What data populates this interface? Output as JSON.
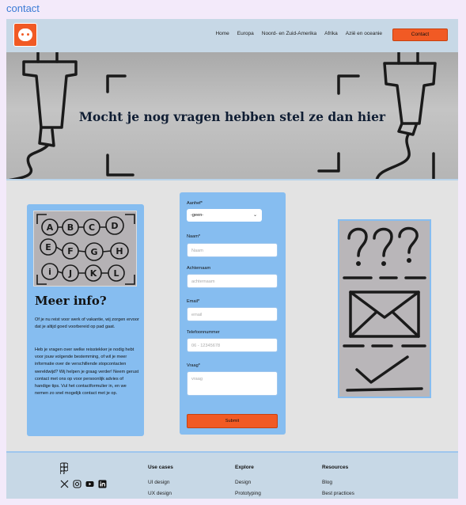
{
  "page_label": "contact",
  "header": {
    "nav": [
      "Home",
      "Europa",
      "Noord- en Zuid-Amerika",
      "Afrika",
      "Azië en oceanie"
    ],
    "contact_button": "Contact"
  },
  "hero": {
    "title": "Mocht je nog vragen hebben stel ze dan hier"
  },
  "info": {
    "title": "Meer info?",
    "p1": "Of je nu reist voor werk of vakantie, wij zorgen ervoor dat je altijd goed voorbereid op pad gaat.",
    "p2": "Heb je vragen over welke reisstekker je nodig hebt voor jouw volgende bestemming, of wil je meer informatie over de verschillende stopcontacten wereldwijd? Wij helpen je graag verder! Neem gerust contact met ons op voor persoonlijk advies of handige tips. Vul het contactformulier in, en we nemen zo snel mogelijk contact met je op."
  },
  "form": {
    "aanhef_label": "Aanhef*",
    "aanhef_value": "-geen-",
    "naam_label": "Naam*",
    "naam_placeholder": "Naam",
    "achternaam_label": "Achternaam",
    "achternaam_placeholder": "achternaam",
    "email_label": "Email*",
    "email_placeholder": "email",
    "telefoon_label": "Telefoonnummer",
    "telefoon_placeholder": "06 - 12345678",
    "vraag_label": "Vraag*",
    "vraag_placeholder": "vraag",
    "submit": "Submit"
  },
  "footer": {
    "columns": [
      {
        "heading": "Use cases",
        "items": [
          "UI design",
          "UX design"
        ]
      },
      {
        "heading": "Explore",
        "items": [
          "Design",
          "Prototyping"
        ]
      },
      {
        "heading": "Resources",
        "items": [
          "Blog",
          "Best practices"
        ]
      }
    ]
  },
  "colors": {
    "accent_orange": "#f15a24",
    "card_blue": "#86bdf0",
    "header_blue": "#c7d8e6"
  },
  "icons": [
    "figma-icon",
    "x-icon",
    "instagram-icon",
    "youtube-icon",
    "linkedin-icon"
  ]
}
